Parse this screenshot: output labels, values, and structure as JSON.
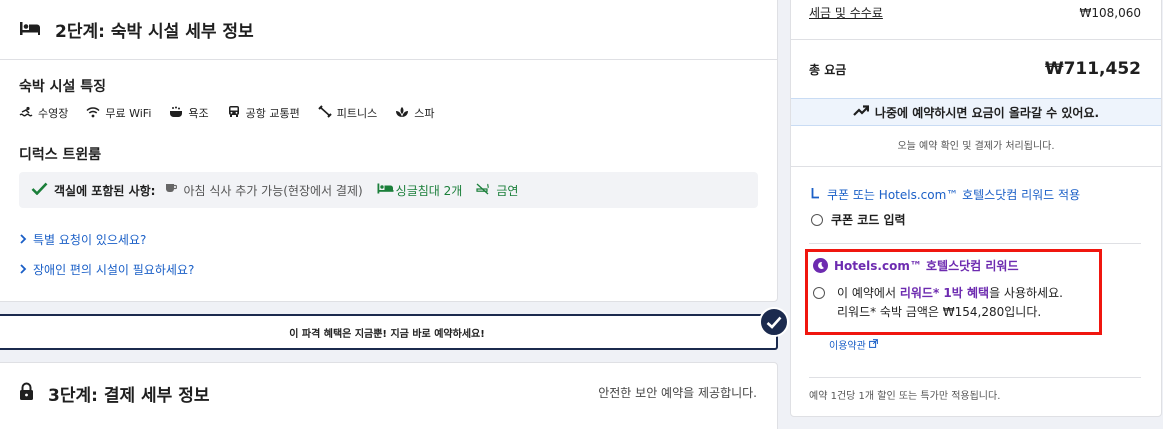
{
  "step2": {
    "title": "2단계: 숙박 시설 세부 정보",
    "features_title": "숙박 시설 특징",
    "amenities": [
      {
        "icon": "pool-icon",
        "label": "수영장"
      },
      {
        "icon": "wifi-icon",
        "label": "무료 WiFi"
      },
      {
        "icon": "bath-icon",
        "label": "욕조"
      },
      {
        "icon": "bus-icon",
        "label": "공항 교통편"
      },
      {
        "icon": "fitness-icon",
        "label": "피트니스"
      },
      {
        "icon": "spa-icon",
        "label": "스파"
      }
    ],
    "room_name": "디럭스 트윈룸",
    "included_label": "객실에 포함된 사항:",
    "breakfast": "아침 식사 추가 가능(현장에서 결제)",
    "beds": "싱글침대 2개",
    "smoking": "금연",
    "special_request_link": "특별 요청이 있으세요?",
    "accessibility_link": "장애인 편의 시설이 필요하세요?"
  },
  "deal_banner": "이 파격 혜택은 지금뿐! 지금 바로 예약하세요!",
  "step3": {
    "title": "3단계: 결제 세부 정보",
    "secure_text": "안전한 보안 예약을 제공합니다."
  },
  "summary": {
    "tax_label": "세금 및 수수료",
    "tax_value": "₩108,060",
    "total_label": "총 요금",
    "total_value": "₩711,452",
    "price_rise": "나중에 예약하시면 요금이 올라갈 수 있어요.",
    "confirm_text": "오늘 예약 확인 및 결제가 처리됩니다.",
    "coupon_link": "쿠폰 또는 Hotels.com™ 호텔스닷컴 리워드 적용",
    "coupon_input": "쿠폰 코드 입력",
    "rewards_title": "Hotels.com™ 호텔스닷컴 리워드",
    "rewards_line1_pre": "이 예약에서 ",
    "rewards_line1_hl1": "리워드* 1박 혜택",
    "rewards_line1_post": "을 사용하세요.",
    "rewards_line2": "리워드* 숙박 금액은 ₩154,280입니다.",
    "terms_link": "이용약관",
    "note": "예약 1건당 1개 할인 또는 특가만 적용됩니다."
  },
  "colors": {
    "accent_blue": "#1a5fc7",
    "navy": "#1b2a4e",
    "rewards_purple": "#6d2bb0",
    "highlight_red": "#f0160f",
    "green": "#1b7f3a"
  }
}
